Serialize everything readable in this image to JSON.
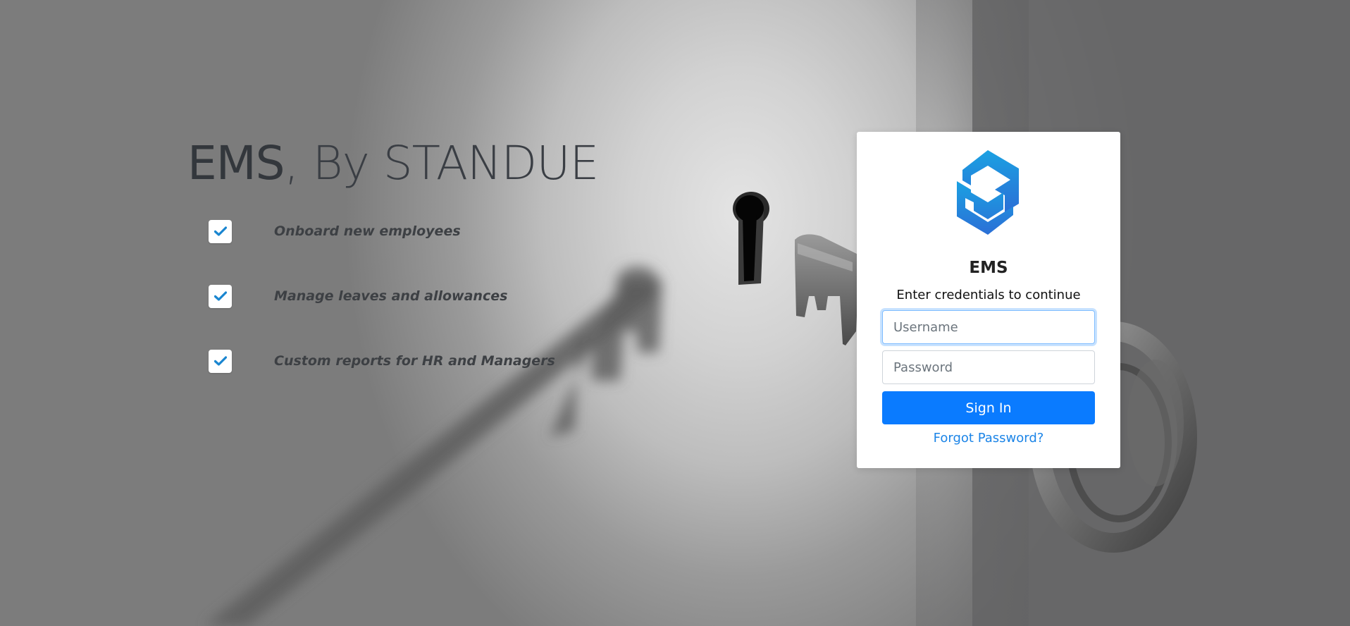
{
  "hero": {
    "brand": "EMS",
    "tagline": ", By STANDUE",
    "features": [
      {
        "icon": "checkmark-icon",
        "label": "Onboard new employees"
      },
      {
        "icon": "checkmark-icon",
        "label": "Manage leaves and allowances"
      },
      {
        "icon": "checkmark-icon",
        "label": "Custom reports for HR and Managers"
      }
    ]
  },
  "login": {
    "logo_icon": "standue-logo-icon",
    "title": "EMS",
    "subtitle": "Enter credentials to continue",
    "username_placeholder": "Username",
    "username_value": "",
    "password_placeholder": "Password",
    "password_value": "",
    "signin_label": "Sign In",
    "forgot_label": "Forgot Password?"
  },
  "colors": {
    "primary": "#0a7bff",
    "link": "#1b84e7",
    "check": "#1a86d0",
    "logo_top": "#1ba1e2",
    "logo_bottom": "#2b6fd6"
  },
  "background": {
    "image": "key-and-keyhole-icon"
  }
}
